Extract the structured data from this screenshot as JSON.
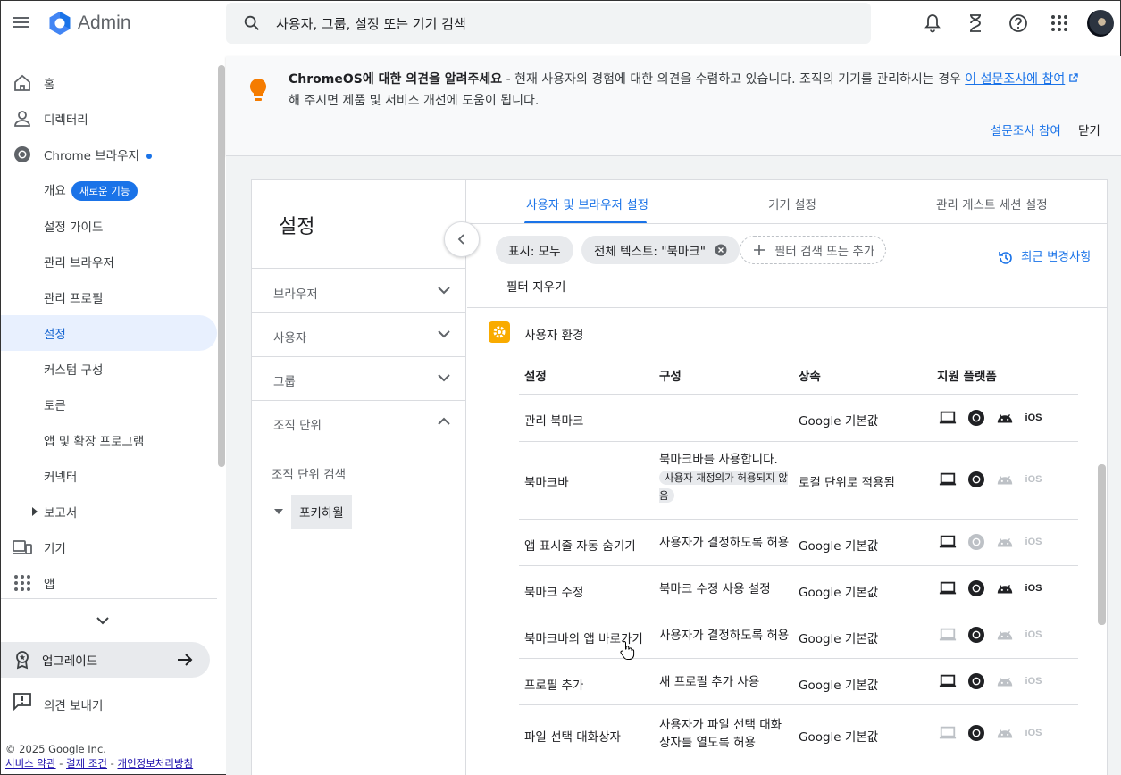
{
  "app": {
    "title": "Admin"
  },
  "search": {
    "placeholder": "사용자, 그룹, 설정 또는 기기 검색"
  },
  "nav": {
    "home": "홈",
    "directory": "디렉터리",
    "chrome_browser": "Chrome 브라우저",
    "overview": "개요",
    "new_badge": "새로운 기능",
    "setup_guide": "설정 가이드",
    "managed_browsers": "관리 브라우저",
    "managed_profiles": "관리 프로필",
    "settings": "설정",
    "customize": "커스텀 구성",
    "tokens": "토큰",
    "apps_extensions": "앱 및 확장 프로그램",
    "connectors": "커넥터",
    "reports": "보고서",
    "devices": "기기",
    "apps": "앱",
    "upgrade": "업그레이드",
    "feedback": "의견 보내기"
  },
  "footer": {
    "copyright": "© 2025 Google Inc.",
    "terms": "서비스 약관",
    "billing": "결제 조건",
    "privacy": "개인정보처리방침",
    "sep": " - "
  },
  "banner": {
    "bold": "ChromeOS에 대한 의견을 알려주세요",
    "text1": " - 현재 사용자의 경험에 대한 의견을 수렴하고 있습니다. 조직의 기기를 관리하시는 경우 ",
    "link": "이 설문조사에 참여",
    "text2": "해 주시면 제품 및 서비스 개선에 도움이 됩니다.",
    "participate": "설문조사 참여",
    "close": "닫기"
  },
  "left_panel": {
    "title": "설정",
    "browser": "브라우저",
    "user": "사용자",
    "group": "그룹",
    "org_unit": "조직 단위",
    "org_search_placeholder": "조직 단위 검색",
    "org_node": "포키하월"
  },
  "tabs": {
    "user_browser": "사용자 및 브라우저 설정",
    "device": "기기 설정",
    "guest": "관리 게스트 세션 설정"
  },
  "filters": {
    "show_all": "표시: 모두",
    "fulltext": "전체 텍스트: \"북마크\"",
    "add_placeholder": "필터 검색 또는 추가",
    "clear": "필터 지우기",
    "recent_changes": "최근 변경사항"
  },
  "section": {
    "title": "사용자 환경",
    "col_setting": "설정",
    "col_config": "구성",
    "col_inherit": "상속",
    "col_platform": "지원 플랫폼"
  },
  "rows": [
    {
      "name": "관리 북마크",
      "config": "",
      "inherit": "Google 기본값"
    },
    {
      "name": "북마크바",
      "config": "북마크바를 사용합니다.",
      "badge": "사용자 재정의가 허용되지 않음",
      "inherit": "로컬 단위로 적용됨"
    },
    {
      "name": "앱 표시줄 자동 숨기기",
      "config": "사용자가 결정하도록 허용",
      "inherit": "Google 기본값"
    },
    {
      "name": "북마크 수정",
      "config": "북마크 수정 사용 설정",
      "inherit": "Google 기본값"
    },
    {
      "name": "북마크바의 앱 바로가기",
      "config": "사용자가 결정하도록 허용",
      "inherit": "Google 기본값"
    },
    {
      "name": "프로필 추가",
      "config": "새 프로필 추가 사용",
      "inherit": "Google 기본값"
    },
    {
      "name": "파일 선택 대화상자",
      "config": "사용자가 파일 선택 대화상자를 열도록 허용",
      "inherit": "Google 기본값"
    }
  ],
  "platform_label": {
    "ios": "iOS"
  },
  "colors": {
    "accent": "#1a73e8",
    "enabled_icon": "#202124",
    "disabled_icon": "#bdc1c6",
    "section_icon": "#f9ab00"
  }
}
